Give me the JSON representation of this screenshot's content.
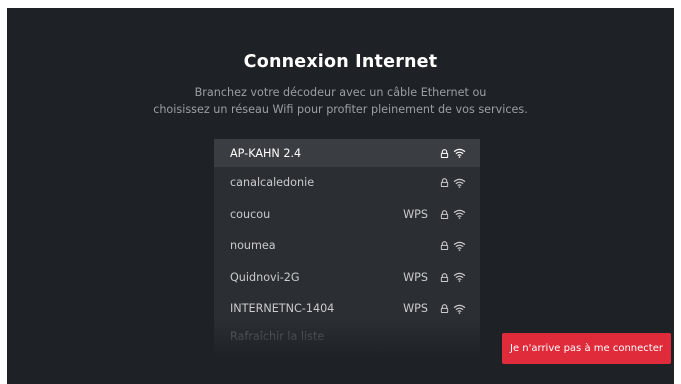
{
  "page": {
    "title": "Connexion Internet",
    "subtitle_line1": "Branchez votre décodeur avec un câble Ethernet ou",
    "subtitle_line2": "choisissez un réseau Wifi pour profiter pleinement de vos services."
  },
  "networks": [
    {
      "name": "AP-KAHN 2.4",
      "wps": "",
      "secured": true,
      "selected": true
    },
    {
      "name": "canalcaledonie",
      "wps": "",
      "secured": true
    },
    {
      "name": "coucou",
      "wps": "WPS",
      "secured": true
    },
    {
      "name": "noumea",
      "wps": "",
      "secured": true
    },
    {
      "name": "Quidnovi-2G",
      "wps": "WPS",
      "secured": true
    },
    {
      "name": "INTERNETNC-1404",
      "wps": "WPS",
      "secured": true
    }
  ],
  "refresh_label": "Rafraîchir la liste",
  "help_button": {
    "label": "Je n'arrive pas à me connecter"
  },
  "icons": {
    "lock": "lock-icon",
    "wifi": "wifi-icon"
  },
  "colors": {
    "background": "#1e2125",
    "panel": "#2b2f33",
    "selected_row": "#3a3e43",
    "accent": "#e02b3a"
  }
}
